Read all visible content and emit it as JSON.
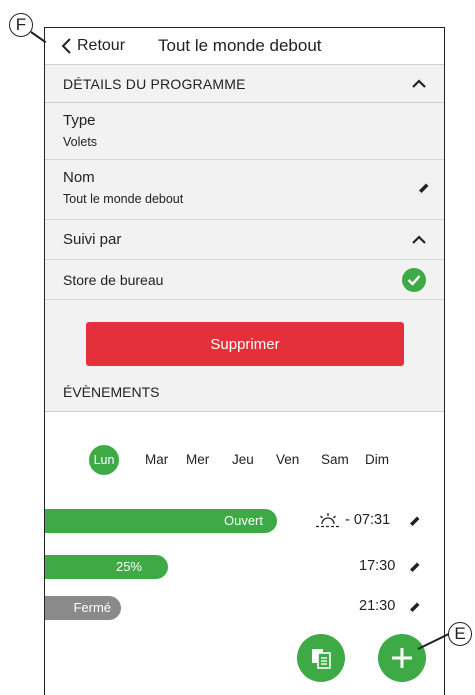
{
  "callouts": {
    "f": "F",
    "e": "E"
  },
  "header": {
    "back_label": "Retour",
    "title": "Tout le monde debout"
  },
  "details": {
    "section_title": "DÉTAILS DU PROGRAMME",
    "type_label": "Type",
    "type_value": "Volets",
    "name_label": "Nom",
    "name_value": "Tout le monde debout",
    "followed_label": "Suivi par",
    "followed_item": "Store de bureau"
  },
  "delete_label": "Supprimer",
  "events": {
    "section_title": "ÉVÈNEMENTS",
    "days": [
      "Lun",
      "Mar",
      "Mer",
      "Jeu",
      "Ven",
      "Sam",
      "Dim"
    ],
    "selected_day": "Lun",
    "items": [
      {
        "label": "Ouvert",
        "time": "- 07:31",
        "icon": "sunrise-icon"
      },
      {
        "label": "25%",
        "time": "17:30"
      },
      {
        "label": "Fermé",
        "time": "21:30"
      }
    ]
  },
  "colors": {
    "accent": "#3daa46",
    "danger": "#e3303a",
    "neutral": "#8a8a8a"
  }
}
